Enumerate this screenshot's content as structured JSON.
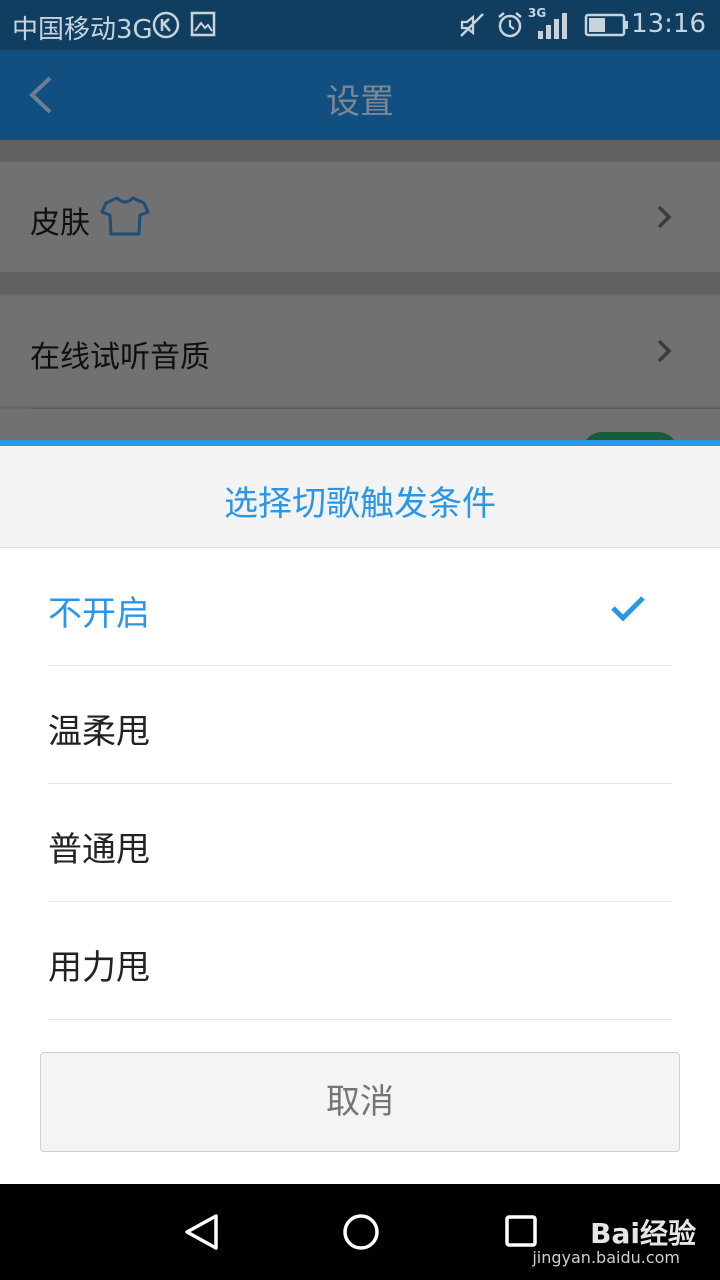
{
  "status_bar": {
    "carrier": "中国移动3G",
    "network": "3G",
    "time": "13:16",
    "icons": [
      "k-badge-icon",
      "image-icon",
      "mute-icon",
      "alarm-icon",
      "signal-icon",
      "battery-icon"
    ]
  },
  "header": {
    "title": "设置",
    "back_icon": "chevron-left-icon"
  },
  "settings": {
    "items": [
      {
        "label": "皮肤",
        "icon": "shirt-icon"
      },
      {
        "label": "在线试听音质"
      }
    ]
  },
  "sheet": {
    "title": "选择切歌触发条件",
    "options": [
      {
        "label": "不开启",
        "selected": true
      },
      {
        "label": "温柔甩",
        "selected": false
      },
      {
        "label": "普通甩",
        "selected": false
      },
      {
        "label": "用力甩",
        "selected": false
      }
    ],
    "cancel_label": "取消"
  },
  "nav_bar": {
    "buttons": [
      "back-triangle-icon",
      "home-circle-icon",
      "recents-square-icon"
    ],
    "watermark": "Bai经验",
    "watermark_url": "jingyan.baidu.com"
  },
  "colors": {
    "accent": "#2a96e8",
    "header_bg": "#114f80",
    "status_bg": "#0f3e61"
  }
}
